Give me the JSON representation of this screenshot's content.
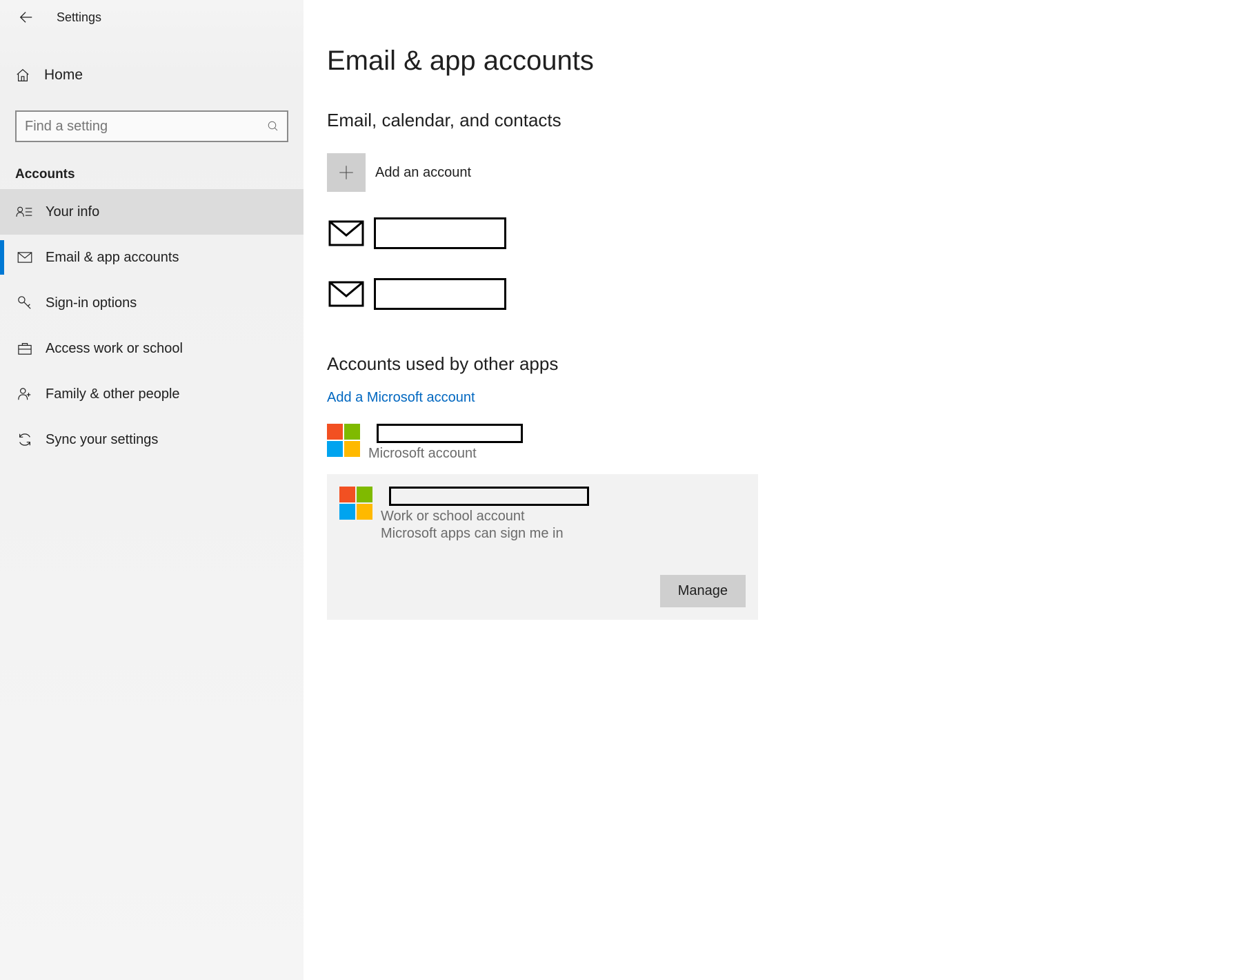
{
  "app": {
    "title": "Settings"
  },
  "sidebar": {
    "home_label": "Home",
    "search_placeholder": "Find a setting",
    "section_header": "Accounts",
    "items": [
      {
        "label": "Your info",
        "icon": "user-list"
      },
      {
        "label": "Email & app accounts",
        "icon": "mail"
      },
      {
        "label": "Sign-in options",
        "icon": "key"
      },
      {
        "label": "Access work or school",
        "icon": "briefcase"
      },
      {
        "label": "Family & other people",
        "icon": "family"
      },
      {
        "label": "Sync your settings",
        "icon": "sync"
      }
    ]
  },
  "main": {
    "page_title": "Email & app accounts",
    "section1_title": "Email, calendar, and contacts",
    "add_account_label": "Add an account",
    "section2_title": "Accounts used by other apps",
    "add_ms_account_label": "Add a Microsoft account",
    "account_a_type": "Microsoft account",
    "account_b_type": "Work or school account",
    "account_b_hint": "Microsoft apps can sign me in",
    "manage_label": "Manage"
  },
  "colors": {
    "accent": "#0078d4",
    "link": "#0067c0"
  }
}
